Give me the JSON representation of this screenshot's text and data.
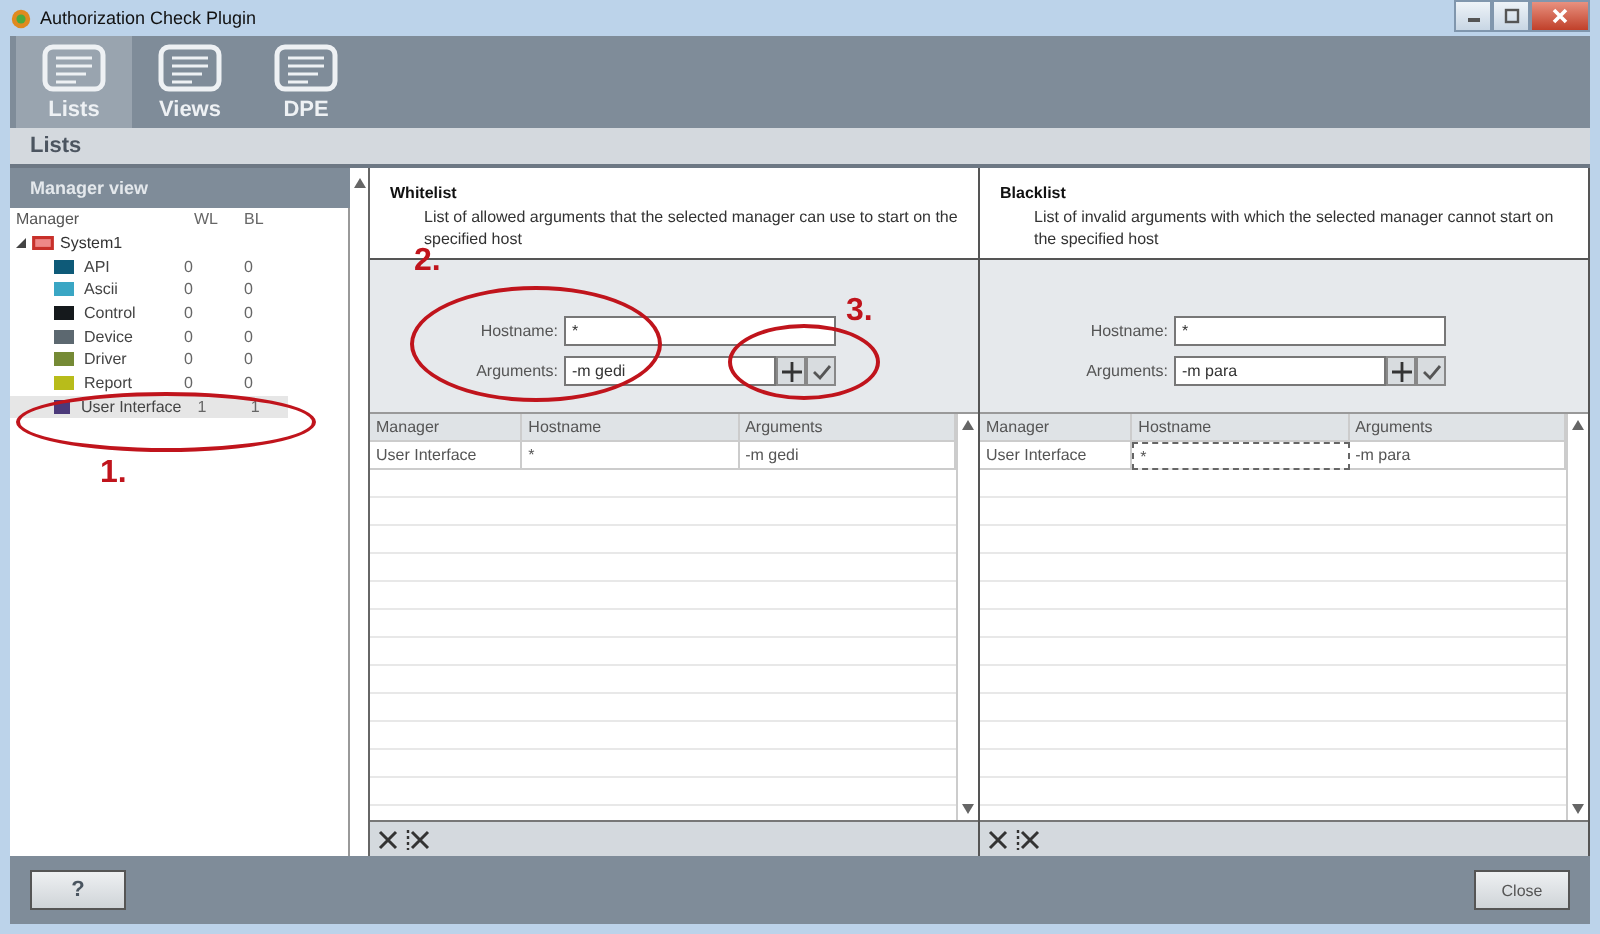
{
  "window": {
    "title": "Authorization Check Plugin"
  },
  "tabs": [
    {
      "label": "Lists",
      "selected": true
    },
    {
      "label": "Views",
      "selected": false
    },
    {
      "label": "DPE",
      "selected": false
    }
  ],
  "section_title": "Lists",
  "manager_view": {
    "title": "Manager view",
    "columns": [
      "Manager",
      "WL",
      "BL"
    ],
    "root": {
      "label": "System1",
      "expanded": true,
      "children": [
        {
          "name": "API",
          "color": "#0e5a78",
          "wl": "0",
          "bl": "0",
          "selected": false
        },
        {
          "name": "Ascii",
          "color": "#3aa6c4",
          "wl": "0",
          "bl": "0",
          "selected": false
        },
        {
          "name": "Control",
          "color": "#15191c",
          "wl": "0",
          "bl": "0",
          "selected": false
        },
        {
          "name": "Device",
          "color": "#5c6870",
          "wl": "0",
          "bl": "0",
          "selected": false
        },
        {
          "name": "Driver",
          "color": "#758a35",
          "wl": "0",
          "bl": "0",
          "selected": false
        },
        {
          "name": "Report",
          "color": "#b8bc1a",
          "wl": "0",
          "bl": "0",
          "selected": false
        },
        {
          "name": "User Interface",
          "color": "#4b3a7a",
          "wl": "1",
          "bl": "1",
          "selected": true
        }
      ]
    }
  },
  "lists": [
    {
      "title": "Whitelist",
      "description": "List of allowed arguments that the selected manager can use to start on the specified host",
      "hostname_label": "Hostname:",
      "hostname": "*",
      "arguments_label": "Arguments:",
      "arguments": "-m gedi",
      "columns": [
        "Manager",
        "Hostname",
        "Arguments"
      ],
      "rows": [
        {
          "cells": [
            {
              "text": "User Interface",
              "focused": false
            },
            {
              "text": "*",
              "focused": false
            },
            {
              "text": "-m gedi",
              "focused": false
            }
          ]
        }
      ]
    },
    {
      "title": "Blacklist",
      "description": "List of invalid arguments with which the selected manager cannot start on the specified host",
      "hostname_label": "Hostname:",
      "hostname": "*",
      "arguments_label": "Arguments:",
      "arguments": "-m para",
      "columns": [
        "Manager",
        "Hostname",
        "Arguments"
      ],
      "rows": [
        {
          "cells": [
            {
              "text": "User Interface",
              "focused": false
            },
            {
              "text": "*",
              "focused": true
            },
            {
              "text": "-m para",
              "focused": false
            }
          ]
        }
      ]
    }
  ],
  "annotations": [
    "1.",
    "2.",
    "3."
  ],
  "buttons": {
    "help": "?",
    "close": "Close"
  }
}
